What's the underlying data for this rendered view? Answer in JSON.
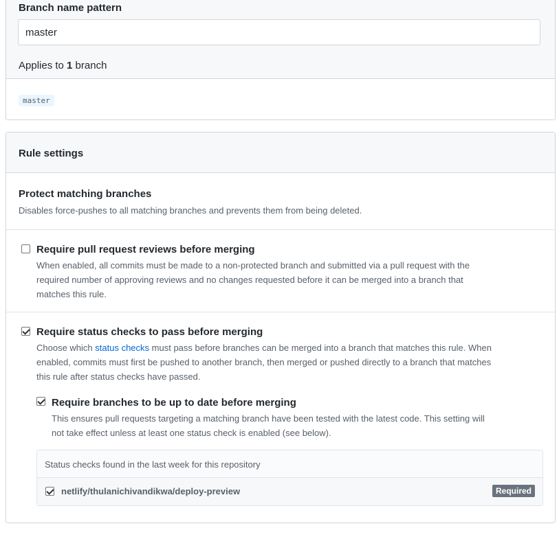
{
  "pattern": {
    "label": "Branch name pattern",
    "value": "master",
    "applies_prefix": "Applies to ",
    "applies_count": "1",
    "applies_suffix": " branch",
    "branch_tag": "master"
  },
  "rules": {
    "title": "Rule settings",
    "protect": {
      "title": "Protect matching branches",
      "description": "Disables force-pushes to all matching branches and prevents them from being deleted."
    },
    "pr_reviews": {
      "checked": false,
      "title": "Require pull request reviews before merging",
      "description_1": "When enabled, all commits must be made to a non-protected branch and submitted via a pull request with the",
      "description_2": "required number of approving reviews and no changes requested before it can be merged into a branch that",
      "description_3": "matches this rule."
    },
    "status_checks": {
      "checked": true,
      "title": "Require status checks to pass before merging",
      "desc_pre": "Choose which ",
      "desc_link": "status checks",
      "desc_post": " must pass before branches can be merged into a branch that matches this rule. When",
      "description_2": "enabled, commits must first be pushed to another branch, then merged or pushed directly to a branch that matches",
      "description_3": "this rule after status checks have passed."
    },
    "up_to_date": {
      "checked": true,
      "title": "Require branches to be up to date before merging",
      "description_1": "This ensures pull requests targeting a matching branch have been tested with the latest code. This setting will",
      "description_2": "not take effect unless at least one status check is enabled (see below)."
    },
    "found_checks": {
      "header": "Status checks found in the last week for this repository",
      "items": [
        {
          "checked": true,
          "name": "netlify/thulanichivandikwa/deploy-preview",
          "badge": "Required"
        }
      ]
    }
  }
}
